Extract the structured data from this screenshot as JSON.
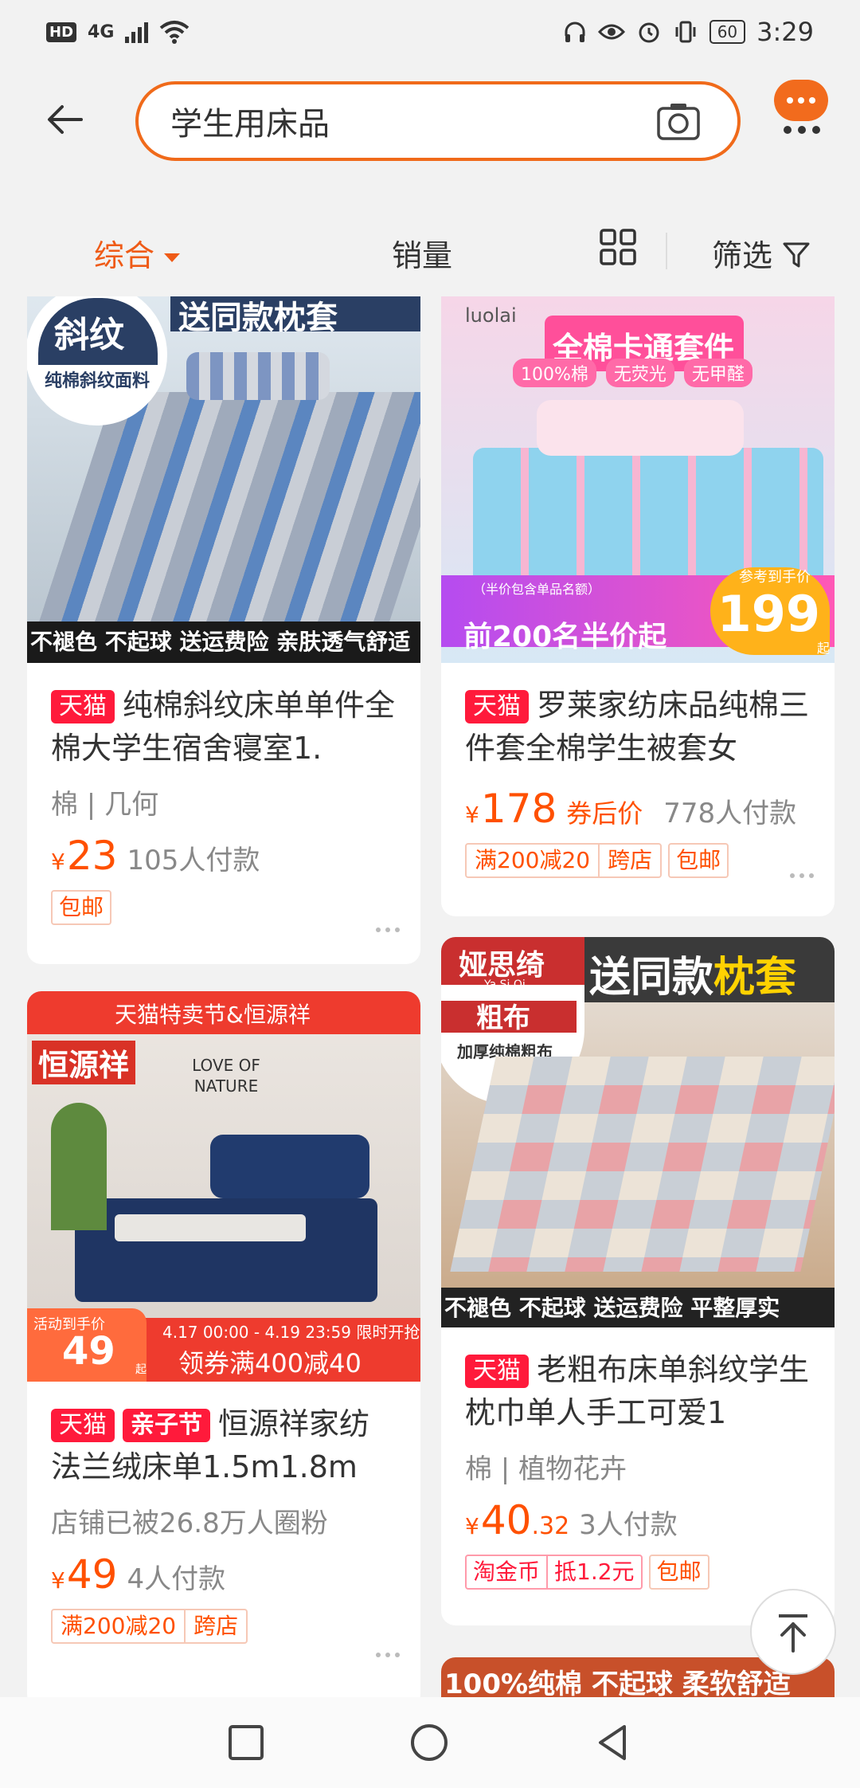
{
  "status_bar": {
    "hd": "HD",
    "net": "4G",
    "time": "3:29",
    "battery": "60"
  },
  "search": {
    "query": "学生用床品"
  },
  "sort_tabs": {
    "comprehensive": "综合",
    "sales": "销量",
    "filter": "筛选"
  },
  "products": [
    {
      "badge": "天猫",
      "title": "纯棉斜纹床单单件全棉大学生宿舍寝室1.",
      "attr": "棉 | 几何",
      "currency": "¥",
      "price": "23",
      "buyers": "105人付款",
      "tags": [
        "包邮"
      ],
      "image": {
        "banner": "送同款枕套",
        "circle_title": "斜纹",
        "circle_sub": "纯棉斜纹面料",
        "overlay": "不褪色 不起球 送运费险 亲肤透气舒适"
      }
    },
    {
      "badge": "天猫",
      "title": "罗莱家纺床品纯棉三件套全棉学生被套女",
      "currency": "¥",
      "price": "178",
      "after": "券后价",
      "buyers": "778人付款",
      "tags": [
        "满200减20",
        "跨店",
        "包邮"
      ],
      "image": {
        "brand": "luolai",
        "banner": "全棉卡通套件",
        "pills": [
          "100%棉",
          "无荧光",
          "无甲醛"
        ],
        "promo": "前200名半价起",
        "ref_price_label": "参考到手价",
        "ref_price": "199",
        "ref_unit": "起",
        "small_note": "（半价包含单品名额）"
      }
    },
    {
      "badge": "天猫",
      "badge2": "亲子节",
      "title": "恒源祥家纺法兰绒床单1.5m1.8m",
      "attr": "店铺已被26.8万人圈粉",
      "currency": "¥",
      "price": "49",
      "buyers": "4人付款",
      "tags": [
        "满200减20",
        "跨店"
      ],
      "image": {
        "top_banner": "天猫特卖节&恒源祥",
        "brand": "恒源祥",
        "wall_text": "LOVE OF NATURE",
        "promo_label": "活动到手价",
        "promo_price": "49",
        "promo_unit": "起",
        "date_range": "4.17 00:00 - 4.19 23:59 限时开抢",
        "coupon": "领券满400减40"
      }
    },
    {
      "badge": "天猫",
      "title": "老粗布床单斜纹学生枕巾单人手工可爱1",
      "attr": "棉 | 植物花卉",
      "currency": "¥",
      "price": "40",
      "price_decimal": ".32",
      "buyers": "3人付款",
      "tags": [
        "淘金币",
        "抵1.2元",
        "包邮"
      ],
      "image": {
        "brand": "娅思绮",
        "brand_sub": "Ya Si Qi",
        "banner_a": "送同款",
        "banner_b": "枕套",
        "circle_title": "粗布",
        "circle_sub": "加厚纯棉粗布",
        "overlay": "不褪色 不起球 送运费险 平整厚实"
      }
    }
  ],
  "next_card_banner": "100%纯棉 不起球 柔软舒适",
  "colors": {
    "accent": "#ff5000",
    "tmall": "#ff1a3b",
    "search_border": "#f06a1a"
  }
}
